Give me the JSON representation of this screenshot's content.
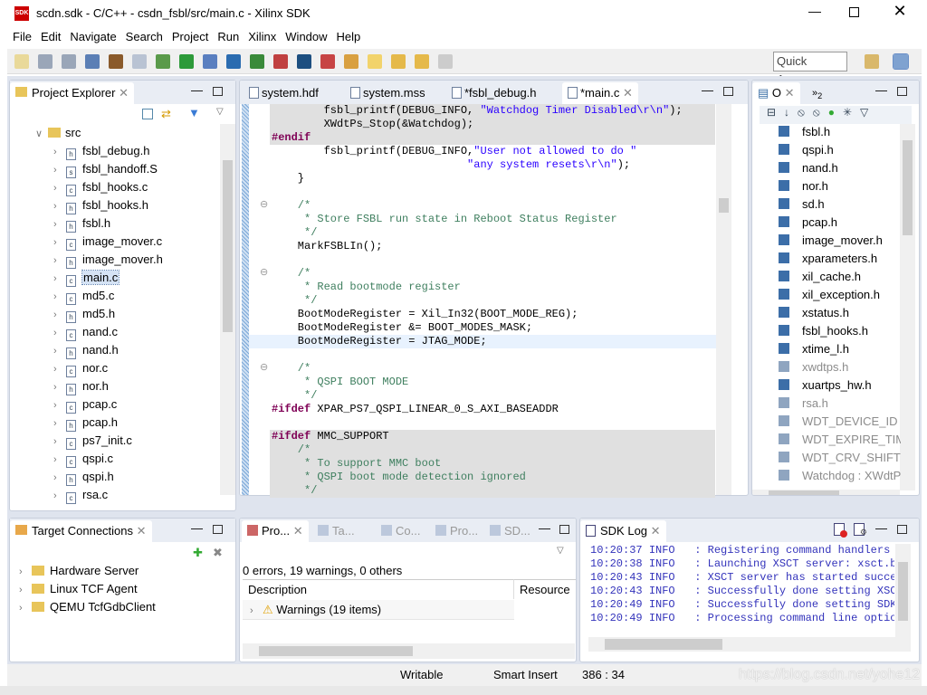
{
  "window": {
    "title": "scdn.sdk - C/C++ - csdn_fsbl/src/main.c - Xilinx SDK",
    "logo": "SDK"
  },
  "menu": [
    "File",
    "Edit",
    "Navigate",
    "Search",
    "Project",
    "Run",
    "Xilinx",
    "Window",
    "Help"
  ],
  "toolbar": {
    "quick_access": "Quick Access"
  },
  "project_explorer": {
    "title": "Project Explorer",
    "folder": "src",
    "items": [
      {
        "name": "fsbl_debug.h",
        "type": "h"
      },
      {
        "name": "fsbl_handoff.S",
        "type": "S"
      },
      {
        "name": "fsbl_hooks.c",
        "type": "c"
      },
      {
        "name": "fsbl_hooks.h",
        "type": "h"
      },
      {
        "name": "fsbl.h",
        "type": "h"
      },
      {
        "name": "image_mover.c",
        "type": "c"
      },
      {
        "name": "image_mover.h",
        "type": "h"
      },
      {
        "name": "main.c",
        "type": "c",
        "selected": true
      },
      {
        "name": "md5.c",
        "type": "c"
      },
      {
        "name": "md5.h",
        "type": "h"
      },
      {
        "name": "nand.c",
        "type": "c"
      },
      {
        "name": "nand.h",
        "type": "h"
      },
      {
        "name": "nor.c",
        "type": "c"
      },
      {
        "name": "nor.h",
        "type": "h"
      },
      {
        "name": "pcap.c",
        "type": "c"
      },
      {
        "name": "pcap.h",
        "type": "h"
      },
      {
        "name": "ps7_init.c",
        "type": "c"
      },
      {
        "name": "qspi.c",
        "type": "c"
      },
      {
        "name": "qspi.h",
        "type": "h"
      },
      {
        "name": "rsa.c",
        "type": "c"
      }
    ]
  },
  "editor": {
    "tabs": [
      {
        "label": "system.hdf"
      },
      {
        "label": "system.mss"
      },
      {
        "label": "*fsbl_debug.h"
      },
      {
        "label": "*main.c",
        "active": true
      }
    ],
    "lines": [
      {
        "bg": "gray",
        "seg": [
          [
            "n",
            "        fsbl_printf(DEBUG_INFO, "
          ],
          [
            "s",
            "\"Watchdog Timer Disabled\\r\\n\""
          ],
          [
            "n",
            ");"
          ]
        ]
      },
      {
        "bg": "gray",
        "seg": [
          [
            "n",
            "        XWdtPs_Stop(&Watchdog);"
          ]
        ]
      },
      {
        "bg": "gray",
        "seg": [
          [
            "p",
            "#endif"
          ]
        ]
      },
      {
        "seg": [
          [
            "n",
            "        fsbl_printf(DEBUG_INFO,"
          ],
          [
            "s",
            "\"User not allowed to do \""
          ]
        ]
      },
      {
        "seg": [
          [
            "n",
            "                              "
          ],
          [
            "s",
            "\"any system resets\\r\\n\""
          ],
          [
            "n",
            ");"
          ]
        ]
      },
      {
        "seg": [
          [
            "n",
            "    }"
          ]
        ]
      },
      {
        "seg": []
      },
      {
        "fold": true,
        "seg": [
          [
            "c",
            "    /*"
          ]
        ]
      },
      {
        "seg": [
          [
            "c",
            "     * Store FSBL run state in Reboot Status Register"
          ]
        ]
      },
      {
        "seg": [
          [
            "c",
            "     */"
          ]
        ]
      },
      {
        "seg": [
          [
            "n",
            "    MarkFSBLIn();"
          ]
        ]
      },
      {
        "seg": []
      },
      {
        "fold": true,
        "seg": [
          [
            "c",
            "    /*"
          ]
        ]
      },
      {
        "seg": [
          [
            "c",
            "     * Read bootmode register"
          ]
        ]
      },
      {
        "seg": [
          [
            "c",
            "     */"
          ]
        ]
      },
      {
        "seg": [
          [
            "n",
            "    BootModeRegister = Xil_In32(BOOT_MODE_REG);"
          ]
        ]
      },
      {
        "seg": [
          [
            "n",
            "    BootModeRegister &= BOOT_MODES_MASK;"
          ]
        ]
      },
      {
        "bg": "current",
        "seg": [
          [
            "n",
            "    BootModeRegister = JTAG_MODE;"
          ]
        ]
      },
      {
        "seg": []
      },
      {
        "fold": true,
        "seg": [
          [
            "c",
            "    /*"
          ]
        ]
      },
      {
        "seg": [
          [
            "c",
            "     * QSPI BOOT MODE"
          ]
        ]
      },
      {
        "seg": [
          [
            "c",
            "     */"
          ]
        ]
      },
      {
        "seg": [
          [
            "p",
            "#ifdef"
          ],
          [
            "n",
            " XPAR_PS7_QSPI_LINEAR_0_S_AXI_BASEADDR"
          ]
        ]
      },
      {
        "seg": []
      },
      {
        "bg": "gray",
        "seg": [
          [
            "p",
            "#ifdef"
          ],
          [
            "n",
            " MMC_SUPPORT"
          ]
        ]
      },
      {
        "bg": "gray",
        "seg": [
          [
            "c",
            "    /*"
          ]
        ]
      },
      {
        "bg": "gray",
        "seg": [
          [
            "c",
            "     * To support MMC boot"
          ]
        ]
      },
      {
        "bg": "gray",
        "seg": [
          [
            "c",
            "     * QSPI boot mode detection ignored"
          ]
        ]
      },
      {
        "bg": "gray",
        "seg": [
          [
            "c",
            "     */"
          ]
        ]
      }
    ]
  },
  "outline": {
    "title": "O",
    "overflow": "2",
    "items": [
      {
        "name": "fsbl.h"
      },
      {
        "name": "qspi.h"
      },
      {
        "name": "nand.h"
      },
      {
        "name": "nor.h"
      },
      {
        "name": "sd.h"
      },
      {
        "name": "pcap.h"
      },
      {
        "name": "image_mover.h"
      },
      {
        "name": "xparameters.h"
      },
      {
        "name": "xil_cache.h"
      },
      {
        "name": "xil_exception.h"
      },
      {
        "name": "xstatus.h"
      },
      {
        "name": "fsbl_hooks.h"
      },
      {
        "name": "xtime_l.h"
      },
      {
        "name": "xwdtps.h",
        "inactive": true
      },
      {
        "name": "xuartps_hw.h"
      },
      {
        "name": "rsa.h",
        "inactive": true
      },
      {
        "name": "WDT_DEVICE_ID",
        "inactive": true
      },
      {
        "name": "WDT_EXPIRE_TIME",
        "inactive": true
      },
      {
        "name": "WDT_CRV_SHIFT",
        "inactive": true
      },
      {
        "name": "Watchdog : XWdtPs",
        "inactive": true
      }
    ]
  },
  "target_connections": {
    "title": "Target Connections",
    "items": [
      "Hardware Server",
      "Linux TCF Agent",
      "QEMU TcfGdbClient"
    ]
  },
  "problems": {
    "tabs": [
      "Pro...",
      "Ta...",
      "Co...",
      "Pro...",
      "SD..."
    ],
    "summary": "0 errors, 19 warnings, 0 others",
    "columns": [
      "Description",
      "Resource"
    ],
    "rows": [
      "Warnings (19 items)"
    ]
  },
  "sdk_log": {
    "title": "SDK Log",
    "entries": [
      {
        "time": "10:20:37",
        "level": "INFO",
        "msg": ": Registering command handlers fo"
      },
      {
        "time": "10:20:38",
        "level": "INFO",
        "msg": ": Launching XSCT server: xsct.ba"
      },
      {
        "time": "10:20:43",
        "level": "INFO",
        "msg": ": XSCT server has started succes"
      },
      {
        "time": "10:20:43",
        "level": "INFO",
        "msg": ": Successfully done setting XSCT"
      },
      {
        "time": "10:20:49",
        "level": "INFO",
        "msg": ": Successfully done setting SDK w"
      },
      {
        "time": "10:20:49",
        "level": "INFO",
        "msg": ": Processing command line option"
      }
    ]
  },
  "status": {
    "mode": "Writable",
    "insert": "Smart Insert",
    "position": "386 : 34"
  },
  "watermark": "https://blog.csdn.net/yohe12"
}
